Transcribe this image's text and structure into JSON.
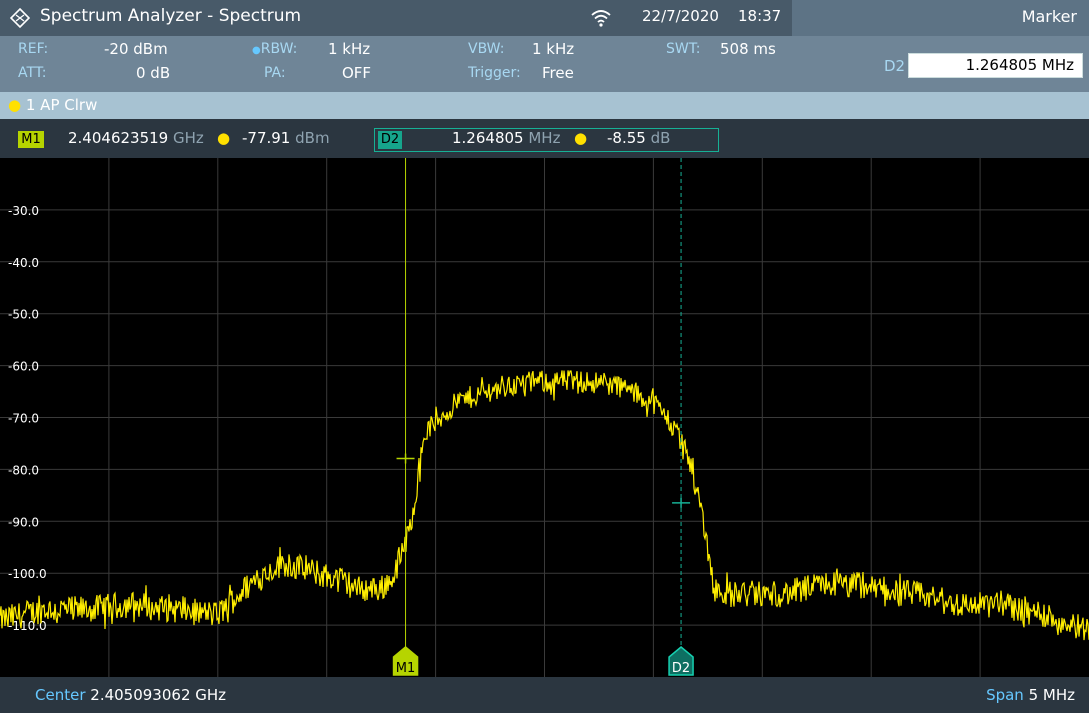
{
  "window": {
    "title": "Spectrum Analyzer - Spectrum",
    "date": "22/7/2020",
    "time": "18:37",
    "panel_title": "Marker"
  },
  "params": {
    "ref_label": "REF:",
    "ref_value": "-20 dBm",
    "att_label": "ATT:",
    "att_value": "0 dB",
    "rbw_label": "RBW:",
    "rbw_value": "1 kHz",
    "pa_label": "PA:",
    "pa_value": "OFF",
    "vbw_label": "VBW:",
    "vbw_value": "1 kHz",
    "trigger_label": "Trigger:",
    "trigger_value": "Free",
    "swt_label": "SWT:",
    "swt_value": "508 ms"
  },
  "marker_panel": {
    "label": "D2",
    "value": "1.264805 MHz"
  },
  "trace": {
    "label": "1 AP  Clrw"
  },
  "markers": {
    "m1_tag": "M1",
    "m1_freq": "2.404623519",
    "m1_freq_unit": "GHz",
    "m1_level": "-77.91",
    "m1_level_unit": "dBm",
    "d2_tag": "D2",
    "d2_freq": "1.264805",
    "d2_freq_unit": "MHz",
    "d2_level": "-8.55",
    "d2_level_unit": "dB"
  },
  "footer": {
    "center_label": "Center",
    "center_value": "2.405093062 GHz",
    "span_label": "Span",
    "span_value": "5 MHz"
  },
  "chart_data": {
    "type": "line",
    "y_tick_labels": [
      "-30.0",
      "-40.0",
      "-50.0",
      "-60.0",
      "-70.0",
      "-80.0",
      "-90.0",
      "-100.0",
      "-110.0"
    ],
    "ylim": [
      -120,
      -20
    ],
    "xlim": [
      -2.5,
      2.5
    ],
    "grid": true,
    "series": [
      {
        "color": "#ffee00",
        "x": [
          -2.5,
          -2.3,
          -2.1,
          -1.9,
          -1.7,
          -1.5,
          -1.35,
          -1.2,
          -1.05,
          -0.95,
          -0.85,
          -0.75,
          -0.7,
          -0.62,
          -0.55,
          -0.4,
          -0.2,
          0.0,
          0.2,
          0.35,
          0.5,
          0.6,
          0.68,
          0.73,
          0.78,
          0.85,
          0.95,
          1.1,
          1.3,
          1.5,
          1.7,
          1.9,
          2.1,
          2.3,
          2.5
        ],
        "y": [
          -109,
          -107,
          -107,
          -106,
          -107,
          -108,
          -102,
          -98,
          -100,
          -101,
          -103,
          -103,
          -101,
          -92,
          -73,
          -67,
          -64,
          -63,
          -63,
          -64,
          -67,
          -72,
          -80,
          -90,
          -103,
          -104,
          -104,
          -104,
          -102,
          -103,
          -104,
          -106,
          -106,
          -108,
          -111
        ]
      }
    ],
    "markers": [
      {
        "name": "M1",
        "x": -0.638,
        "y": -77.91,
        "color": "#b6d400"
      },
      {
        "name": "D2",
        "x": 0.627,
        "y": -86.46,
        "color": "#16b095"
      }
    ]
  }
}
